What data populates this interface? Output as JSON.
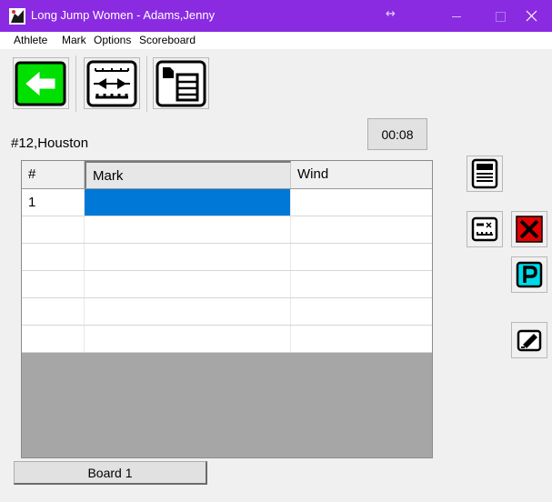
{
  "window": {
    "title": "Long Jump Women - Adams,Jenny",
    "resize_glyph": "↔"
  },
  "menu": [
    "Athlete",
    "Mark",
    "Options",
    "Scoreboard"
  ],
  "toolbar": {
    "back_icon": "back-arrow-icon",
    "measure_icon": "measure-device-icon",
    "scoreboard_icon": "scoreboard-list-icon"
  },
  "athlete_label": "#12,Houston",
  "timer": "00:08",
  "grid": {
    "columns": [
      "#",
      "Mark",
      "Wind"
    ],
    "rows": [
      {
        "num": "1",
        "mark": "",
        "wind": ""
      },
      {
        "num": "",
        "mark": "",
        "wind": ""
      },
      {
        "num": "",
        "mark": "",
        "wind": ""
      },
      {
        "num": "",
        "mark": "",
        "wind": ""
      },
      {
        "num": "",
        "mark": "",
        "wind": ""
      },
      {
        "num": "",
        "mark": "",
        "wind": ""
      }
    ]
  },
  "side_buttons": {
    "calculator_icon": "calculator-icon",
    "device_icon": "measuring-device-icon",
    "foul_icon": "red-x-foul-icon",
    "pass_icon": "pass-p-icon",
    "edit_icon": "eraser-edit-icon"
  },
  "colors": {
    "titlebar": "#8a2be2",
    "selection": "#0078d7",
    "back_green": "#00e000",
    "foul_red": "#e00000",
    "pass_cyan": "#00d8e8"
  },
  "board_button": "Board 1"
}
